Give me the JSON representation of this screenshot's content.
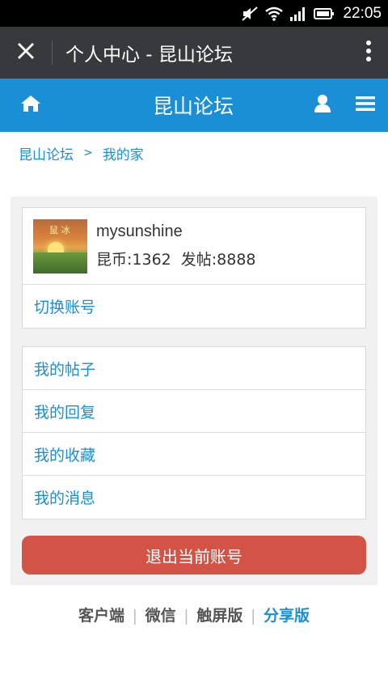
{
  "status_bar": {
    "time": "22:05"
  },
  "browser": {
    "title": "个人中心 - 昆山论坛"
  },
  "header": {
    "site_title": "昆山论坛"
  },
  "breadcrumb": {
    "home": "昆山论坛",
    "separator": ">",
    "current": "我的家"
  },
  "profile": {
    "username": "mysunshine",
    "coins": "昆币:1362",
    "posts": "发帖:8888",
    "avatar_text": "鼠 冰",
    "switch_account": "切换账号"
  },
  "menu": {
    "items": [
      "我的帖子",
      "我的回复",
      "我的收藏",
      "我的消息"
    ]
  },
  "logout_label": "退出当前账号",
  "footer": {
    "links": [
      "客户端",
      "微信",
      "触屏版",
      "分享版"
    ],
    "separator": "|"
  },
  "colors": {
    "accent": "#1a8fd6",
    "browser_bar": "#37393c",
    "logout": "#d35446",
    "panel_bg": "#f1f1f1"
  }
}
